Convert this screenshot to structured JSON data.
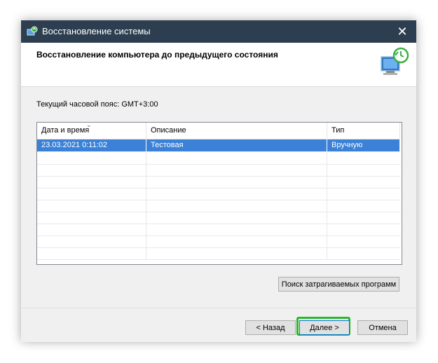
{
  "window": {
    "title": "Восстановление системы",
    "close_glyph": "✕"
  },
  "header": {
    "heading": "Восстановление компьютера до предыдущего состояния"
  },
  "timezone": {
    "label": "Текущий часовой пояс: GMT+3:00"
  },
  "restore_points": {
    "columns": [
      "Дата и время",
      "Описание",
      "Тип"
    ],
    "rows": [
      {
        "datetime": "23.03.2021 0:11:02",
        "description": "Тестовая",
        "type": "Вручную",
        "selected": true
      }
    ]
  },
  "buttons": {
    "scan": "Поиск затрагиваемых программ",
    "back": "< Назад",
    "next": "Далее >",
    "cancel": "Отмена"
  },
  "colors": {
    "titlebar": "#2d3e50",
    "selection": "#3a81d7",
    "highlight": "#2bb82b"
  }
}
